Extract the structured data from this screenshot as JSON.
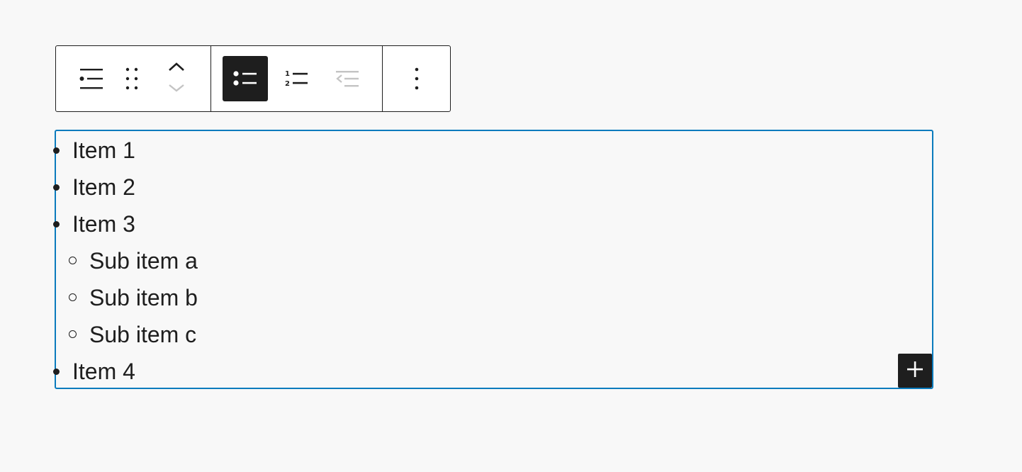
{
  "toolbar": {
    "buttons": [
      {
        "name": "list-block-type",
        "icon": "list-block-icon"
      },
      {
        "name": "drag-handle",
        "icon": "drag-handle-icon"
      },
      {
        "name": "move-up",
        "icon": "chevron-up-icon"
      },
      {
        "name": "move-down",
        "icon": "chevron-down-icon",
        "disabled": true
      },
      {
        "name": "unordered-list",
        "icon": "bullet-list-icon",
        "active": true
      },
      {
        "name": "ordered-list",
        "icon": "numbered-list-icon"
      },
      {
        "name": "outdent",
        "icon": "outdent-icon",
        "disabled": true
      },
      {
        "name": "options",
        "icon": "more-vertical-icon"
      }
    ],
    "ordered_icon_digits": [
      "1",
      "2"
    ]
  },
  "list": {
    "items": [
      {
        "label": "Item 1",
        "children": []
      },
      {
        "label": "Item 2",
        "children": []
      },
      {
        "label": "Item 3",
        "children": [
          {
            "label": "Sub item a"
          },
          {
            "label": "Sub item b"
          },
          {
            "label": "Sub item c"
          }
        ]
      },
      {
        "label": "Item 4",
        "children": []
      }
    ]
  },
  "colors": {
    "background": "#f8f8f8",
    "text": "#1e1e1e",
    "selection_border": "#0a7bbd",
    "disabled_icon": "#c4c4c4",
    "active_button": "#1e1e1e"
  }
}
